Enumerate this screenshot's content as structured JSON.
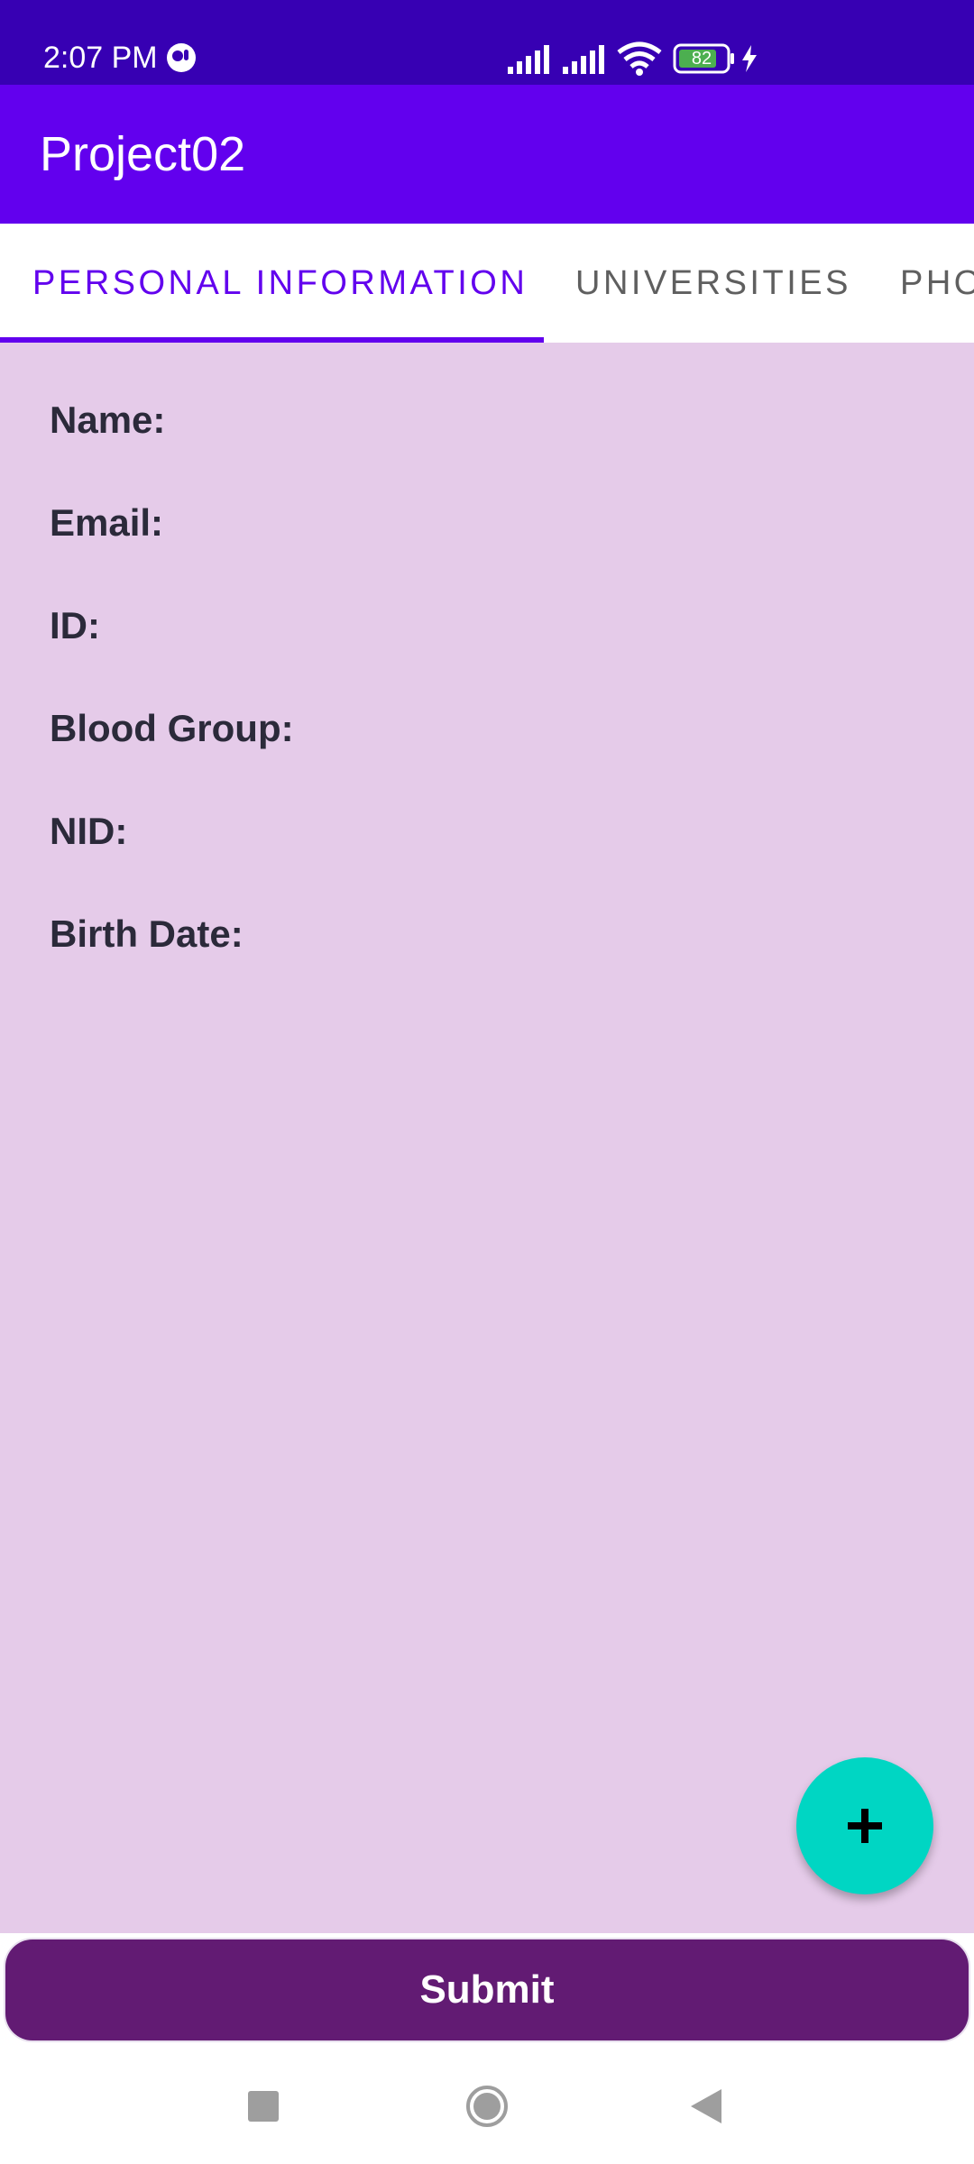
{
  "status_bar": {
    "time": "2:07 PM",
    "battery": "82",
    "icons": [
      "notification-icon",
      "signal-icon",
      "signal-icon",
      "wifi-icon",
      "battery-icon",
      "charging-icon"
    ]
  },
  "app": {
    "title": "Project02"
  },
  "tabs": [
    {
      "label": "PERSONAL INFORMATION",
      "selected": true
    },
    {
      "label": "UNIVERSITIES",
      "selected": false
    },
    {
      "label": "PHO",
      "selected": false
    }
  ],
  "fields": [
    {
      "label": "Name:"
    },
    {
      "label": "Email:"
    },
    {
      "label": "ID:"
    },
    {
      "label": "Blood Group:"
    },
    {
      "label": "NID:"
    },
    {
      "label": "Birth Date:"
    }
  ],
  "fab": {
    "icon": "plus-icon"
  },
  "submit": {
    "label": "Submit"
  },
  "nav": {
    "icons": [
      "recents-icon",
      "home-icon",
      "back-icon"
    ]
  },
  "colors": {
    "status_bar": "#3700b3",
    "app_bar": "#6200ee",
    "accent": "#6200ee",
    "content_bg": "#e5cbe9",
    "fab": "#00d6c3",
    "submit": "#621b73"
  }
}
